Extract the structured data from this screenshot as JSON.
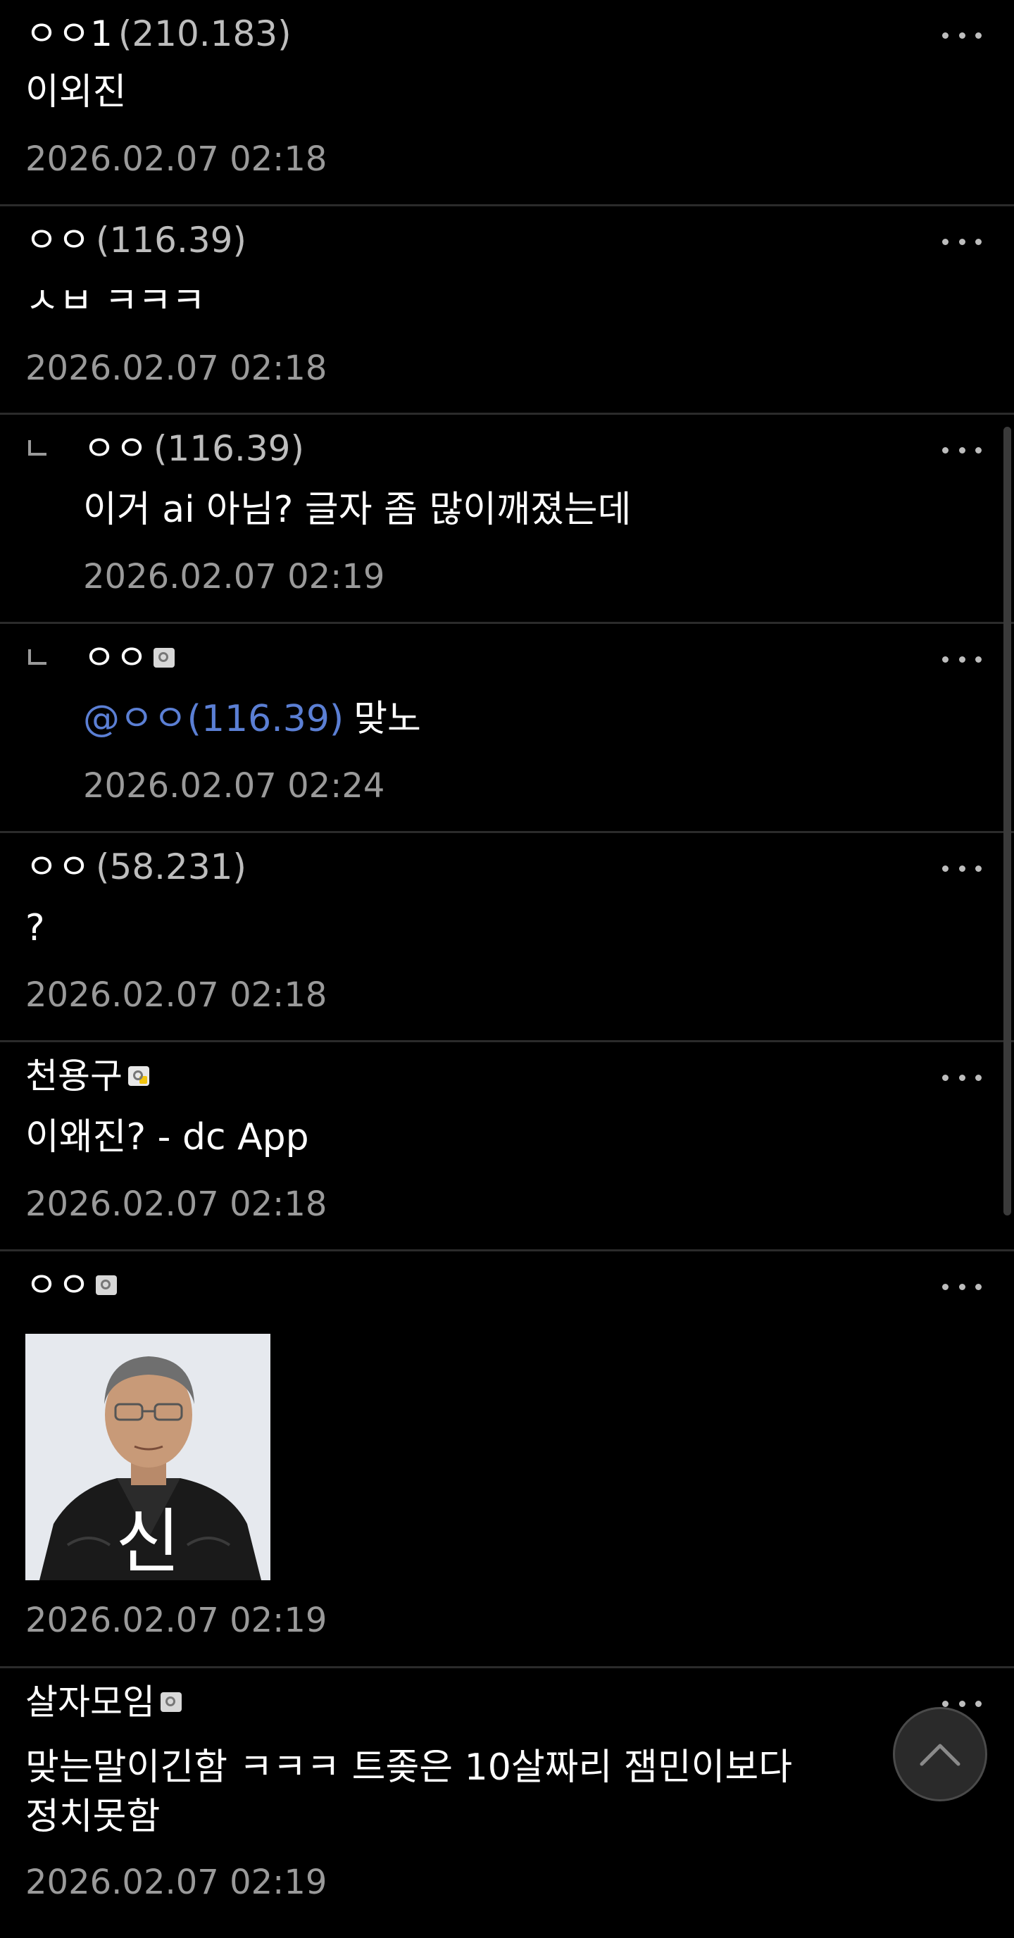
{
  "comments": [
    {
      "nick": "ㅇㅇ1",
      "ip": "(210.183)",
      "text": "이외진",
      "date": "2026.02.07 02:18"
    },
    {
      "nick": "ㅇㅇ",
      "ip": "(116.39)",
      "text": "ㅅㅂ ㅋㅋㅋ",
      "date": "2026.02.07 02:18"
    },
    {
      "nick": "ㅇㅇ",
      "ip": "(116.39)",
      "text": "이거 ai 아님? 글자 좀 많이깨졌는데",
      "date": "2026.02.07 02:19"
    },
    {
      "nick": "ㅇㅇ",
      "mention": "@ㅇㅇ(116.39)",
      "text": "맞노",
      "date": "2026.02.07 02:24"
    },
    {
      "nick": "ㅇㅇ",
      "ip": "(58.231)",
      "text": "?",
      "date": "2026.02.07 02:18"
    },
    {
      "nick": "천용구",
      "text": "이왜진? - dc App",
      "date": "2026.02.07 02:18"
    },
    {
      "nick": "ㅇㅇ",
      "image_caption": "신",
      "date": "2026.02.07 02:19"
    },
    {
      "nick": "살자모임",
      "text_line1": "맞는말이긴함 ㅋㅋㅋ 트좆은 10살짜리 잼민이보다",
      "text_line2": "정치못함",
      "date": "2026.02.07 02:19"
    }
  ],
  "icons": {
    "more": "more-dots-icon",
    "scroll_top": "chevron-up-icon",
    "member_badge": "member-badge-icon"
  },
  "colors": {
    "background": "#000000",
    "mention": "#5b7fd4",
    "date": "#9a9a9a",
    "divider": "#2b2b2b"
  }
}
